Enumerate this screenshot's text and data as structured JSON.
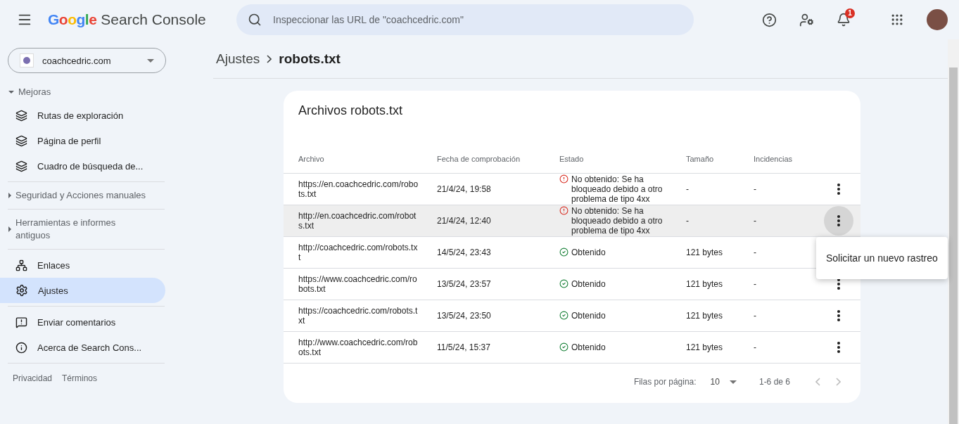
{
  "header": {
    "product_brand": "Google",
    "product_name": "Search Console",
    "search": {
      "placeholder": "Inspeccionar las URL de \"coachcedric.com\""
    },
    "notifications": "1"
  },
  "sidebar": {
    "property": "coachcedric.com",
    "sections": [
      {
        "kind": "group",
        "label": "Mejoras",
        "expanded": true,
        "items": [
          {
            "kind": "layers",
            "label": "Rutas de exploración",
            "selected": false
          },
          {
            "kind": "layers",
            "label": "Página de perfil",
            "selected": false
          },
          {
            "kind": "layers",
            "label": "Cuadro de búsqueda de...",
            "selected": false
          }
        ]
      },
      {
        "kind": "group",
        "label": "Seguridad y Acciones manuales",
        "expanded": false
      },
      {
        "kind": "group",
        "label": "Herramientas e informes antiguos",
        "expanded": false
      },
      {
        "kind": "links",
        "items": [
          {
            "kind": "network",
            "label": "Enlaces",
            "selected": false
          },
          {
            "kind": "settings",
            "label": "Ajustes",
            "selected": true
          }
        ]
      },
      {
        "kind": "links",
        "items": [
          {
            "kind": "feedback",
            "label": "Enviar comentarios",
            "selected": false
          },
          {
            "kind": "info",
            "label": "Acerca de Search Cons...",
            "selected": false
          }
        ]
      }
    ],
    "footer": [
      "Privacidad",
      "Términos"
    ]
  },
  "breadcrumb": {
    "parent": "Ajustes",
    "current": "robots.txt"
  },
  "card": {
    "title": "Archivos robots.txt",
    "columns": [
      "Archivo",
      "Fecha de comprobación",
      "Estado",
      "Tamaño",
      "Incidencias"
    ],
    "rows": [
      {
        "file": "https://en.coachcedric.com/robots.txt",
        "date": "21/4/24, 19:58",
        "status": {
          "kind": "error",
          "text": "No obtenido: Se ha bloqueado debido a otro problema de tipo 4xx"
        },
        "size": "-",
        "issues": "-",
        "highlighted": false,
        "menu_open": false
      },
      {
        "file": "http://en.coachcedric.com/robots.txt",
        "date": "21/4/24, 12:40",
        "status": {
          "kind": "error",
          "text": "No obtenido: Se ha bloqueado debido a otro problema de tipo 4xx"
        },
        "size": "-",
        "issues": "-",
        "highlighted": true,
        "menu_open": true
      },
      {
        "file": "http://coachcedric.com/robots.txt",
        "date": "14/5/24, 23:43",
        "status": {
          "kind": "ok",
          "text": "Obtenido"
        },
        "size": "121 bytes",
        "issues": "-",
        "highlighted": false,
        "menu_open": false
      },
      {
        "file": "https://www.coachcedric.com/robots.txt",
        "date": "13/5/24, 23:57",
        "status": {
          "kind": "ok",
          "text": "Obtenido"
        },
        "size": "121 bytes",
        "issues": "-",
        "highlighted": false,
        "menu_open": false
      },
      {
        "file": "https://coachcedric.com/robots.txt",
        "date": "13/5/24, 23:50",
        "status": {
          "kind": "ok",
          "text": "Obtenido"
        },
        "size": "121 bytes",
        "issues": "-",
        "highlighted": false,
        "menu_open": false
      },
      {
        "file": "http://www.coachcedric.com/robots.txt",
        "date": "11/5/24, 15:37",
        "status": {
          "kind": "ok",
          "text": "Obtenido"
        },
        "size": "121 bytes",
        "issues": "-",
        "highlighted": false,
        "menu_open": false
      }
    ],
    "menu": [
      "Solicitar un nuevo rastreo"
    ],
    "pagination": {
      "rows_label": "Filas por página:",
      "rows_value": "10",
      "range": "1-6 de 6"
    }
  }
}
